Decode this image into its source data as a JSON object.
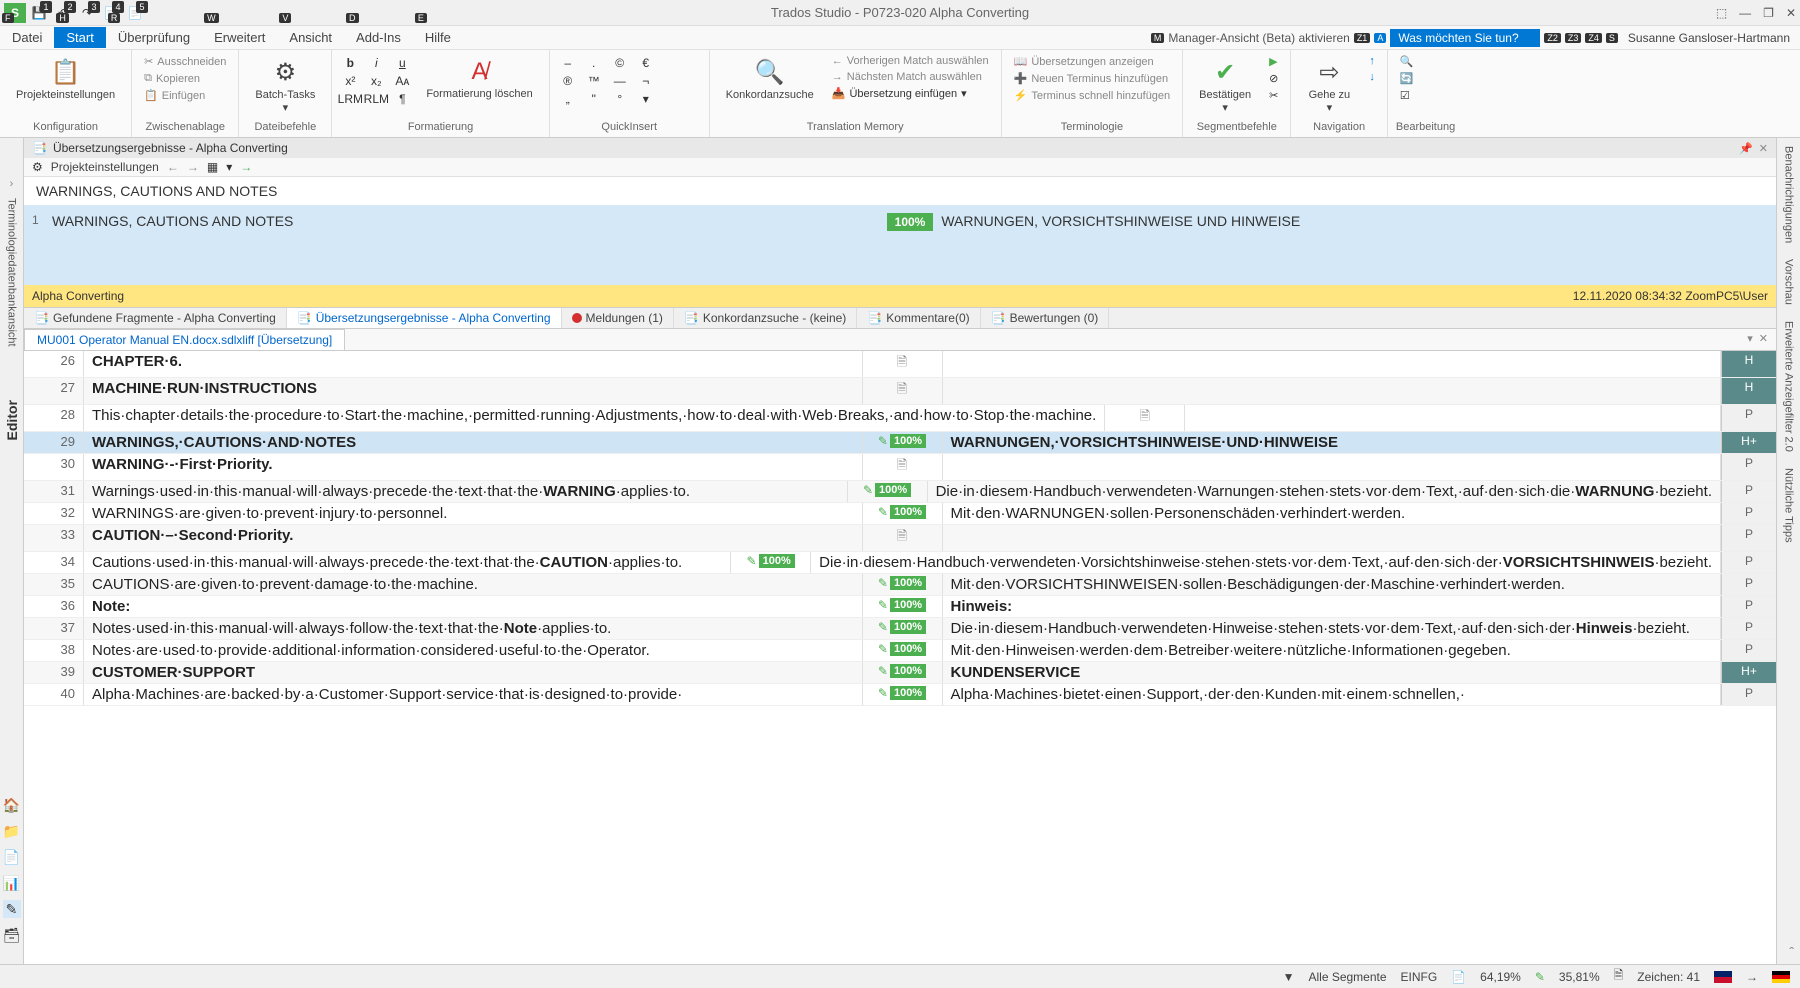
{
  "title": "Trados Studio - P0723-020 Alpha Converting",
  "menubar": {
    "items": [
      "Datei",
      "Start",
      "Überprüfung",
      "Erweitert",
      "Ansicht",
      "Add-Ins",
      "Hilfe"
    ],
    "active_index": 1,
    "manager_link": "Manager-Ansicht (Beta) aktivieren",
    "search_placeholder": "Was möchten Sie tun?",
    "user": "Susanne Gansloser-Hartmann"
  },
  "ribbon": {
    "groups": [
      {
        "label": "Konfiguration",
        "big": "Projekteinstellungen"
      },
      {
        "label": "Zwischenablage",
        "items": [
          "Ausschneiden",
          "Kopieren",
          "Einfügen"
        ]
      },
      {
        "label": "Dateibefehle",
        "big": "Batch-Tasks"
      },
      {
        "label": "Formatierung",
        "big": "Formatierung löschen"
      },
      {
        "label": "QuickInsert"
      },
      {
        "label": "Translation Memory",
        "big": "Konkordanzsuche",
        "items": [
          "Vorherigen Match auswählen",
          "Nächsten Match auswählen",
          "Übersetzung einfügen"
        ]
      },
      {
        "label": "Terminologie",
        "items": [
          "Übersetzungen anzeigen",
          "Neuen Terminus hinzufügen",
          "Terminus schnell hinzufügen"
        ]
      },
      {
        "label": "Segmentbefehle",
        "big": "Bestätigen"
      },
      {
        "label": "Navigation",
        "big": "Gehe zu"
      },
      {
        "label": "Bearbeitung"
      }
    ]
  },
  "tm_panel": {
    "header": "Übersetzungsergebnisse - Alpha Converting",
    "toolbar_link": "Projekteinstellungen",
    "source_line": "WARNINGS, CAUTIONS AND NOTES",
    "match": {
      "num": "1",
      "src": "WARNINGS, CAUTIONS AND NOTES",
      "pct": "100%",
      "tgt": "WARNUNGEN, VORSICHTSHINWEISE UND HINWEISE"
    },
    "footer_left": "Alpha Converting",
    "footer_right": "12.11.2020 08:34:32  ZoomPC5\\User"
  },
  "sub_tabs": [
    {
      "label": "Gefundene Fragmente - Alpha Converting"
    },
    {
      "label": "Übersetzungsergebnisse - Alpha Converting",
      "active": true
    },
    {
      "label": "Meldungen (1)",
      "error": true
    },
    {
      "label": "Konkordanzsuche - (keine)"
    },
    {
      "label": "Kommentare(0)"
    },
    {
      "label": "Bewertungen (0)"
    }
  ],
  "doc_tab": "MU001 Operator Manual EN.docx.sdlxliff [Übersetzung]",
  "segments": [
    {
      "n": 26,
      "src_html": "<b>CHAPTER·6.</b>",
      "status": "doc",
      "tgt": "",
      "ctx": "H",
      "alt": false
    },
    {
      "n": 27,
      "src_html": "<b>MACHINE·RUN·INSTRUCTIONS</b>",
      "status": "doc",
      "tgt": "",
      "ctx": "H",
      "alt": true
    },
    {
      "n": 28,
      "src_html": "This·chapter·details·the·procedure·to·Start·the·machine,·permitted·running·Adjustments,·how·to·deal·with·Web·Breaks,·and·how·to·Stop·the·machine.",
      "status": "doc",
      "tgt": "",
      "ctx": "P",
      "alt": false
    },
    {
      "n": 29,
      "src_html": "<b>WARNINGS,·CAUTIONS·AND·NOTES</b>",
      "status": "100",
      "tgt_html": "<b>WARNUNGEN,·VORSICHTSHINWEISE·UND·HINWEISE</b>",
      "ctx": "H+",
      "active": true
    },
    {
      "n": 30,
      "src_html": "<b>WARNING·-·First·Priority.</b>",
      "status": "doc",
      "tgt": "",
      "ctx": "P",
      "alt": false
    },
    {
      "n": 31,
      "src_html": "Warnings·used·in·this·manual·will·always·precede·the·text·that·the·<b>WARNING</b>·applies·to.",
      "status": "100",
      "tgt_html": "Die·in·diesem·Handbuch·verwendeten·Warnungen·stehen·stets·vor·dem·Text,·auf·den·sich·die·<b>WARNUNG</b>·bezieht.",
      "ctx": "P",
      "alt": true
    },
    {
      "n": 32,
      "src_html": "WARNINGS·are·given·to·prevent·injury·to·personnel.",
      "status": "100",
      "tgt_html": "Mit·den·WARNUNGEN·sollen·Personenschäden·verhindert·werden.",
      "ctx": "P",
      "alt": false
    },
    {
      "n": 33,
      "src_html": "<b>CAUTION·–·Second·Priority.</b>",
      "status": "doc",
      "tgt": "",
      "ctx": "P",
      "alt": true
    },
    {
      "n": 34,
      "src_html": "Cautions·used·in·this·manual·will·always·precede·the·text·that·the·<b>CAUTION</b>·applies·to.",
      "status": "100",
      "tgt_html": "Die·in·diesem·Handbuch·verwendeten·Vorsichtshinweise·stehen·stets·vor·dem·Text,·auf·den·sich·der·<b>VORSICHTSHINWEIS</b>·bezieht.",
      "ctx": "P",
      "alt": false
    },
    {
      "n": 35,
      "src_html": "CAUTIONS·are·given·to·prevent·damage·to·the·machine.",
      "status": "100",
      "tgt_html": "Mit·den·VORSICHTSHINWEISEN·sollen·Beschädigungen·der·Maschine·verhindert·werden.",
      "ctx": "P",
      "alt": true
    },
    {
      "n": 36,
      "src_html": "<b>Note:</b>",
      "status": "100",
      "tgt_html": "<b>Hinweis:</b>",
      "ctx": "P",
      "alt": false
    },
    {
      "n": 37,
      "src_html": "Notes·used·in·this·manual·will·always·follow·the·text·that·the·<b>Note</b>·applies·to.",
      "status": "100",
      "tgt_html": "Die·in·diesem·Handbuch·verwendeten·Hinweise·stehen·stets·vor·dem·Text,·auf·den·sich·der·<b>Hinweis</b>·bezieht.",
      "ctx": "P",
      "alt": true
    },
    {
      "n": 38,
      "src_html": "Notes·are·used·to·provide·additional·information·considered·useful·to·the·Operator.",
      "status": "100",
      "tgt_html": "Mit·den·Hinweisen·werden·dem·Betreiber·weitere·nützliche·Informationen·gegeben.",
      "ctx": "P",
      "alt": false
    },
    {
      "n": 39,
      "src_html": "<b>CUSTOMER·SUPPORT</b>",
      "status": "100",
      "tgt_html": "<b>KUNDENSERVICE</b>",
      "ctx": "H+",
      "alt": true
    },
    {
      "n": 40,
      "src_html": "Alpha·Machines·are·backed·by·a·Customer·Support·service·that·is·designed·to·provide·",
      "status": "100",
      "tgt_html": "Alpha·Machines·bietet·einen·Support,·der·den·Kunden·mit·einem·schnellen,·",
      "ctx": "P",
      "alt": false
    }
  ],
  "left_rail": {
    "term_label": "Terminologiedatenbankansicht",
    "editor_label": "Editor"
  },
  "right_rail": [
    "Benachrichtigungen",
    "Vorschau",
    "Erweiterte Anzeigefilter 2.0",
    "Nützliche Tipps"
  ],
  "statusbar": {
    "filter": "Alle Segmente",
    "mode": "EINFG",
    "pct1": "64,19%",
    "pct2": "35,81%",
    "chars": "Zeichen: 41"
  }
}
